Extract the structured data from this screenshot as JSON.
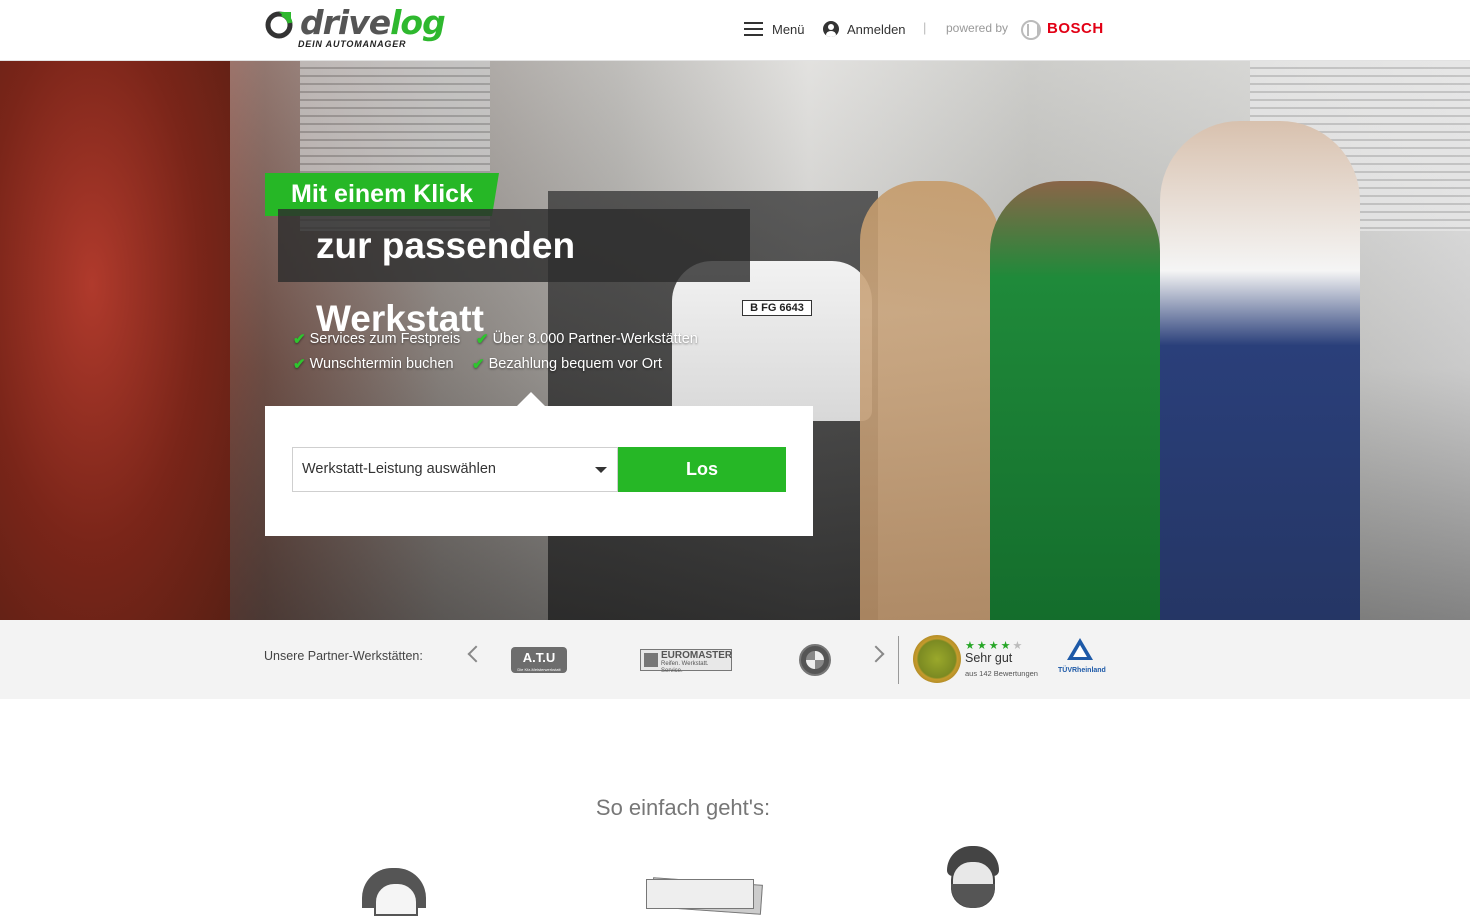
{
  "header": {
    "logo_text_a": "drive",
    "logo_text_b": "log",
    "logo_tagline": "DEIN AUTOMANAGER",
    "menu_label": "Menü",
    "login_label": "Anmelden",
    "separator": "|",
    "powered_by": "powered by",
    "brand": "BOSCH"
  },
  "hero": {
    "headline_1": "Mit einem Klick",
    "headline_2": "zur passenden Werkstatt",
    "plate": "B FG 6643",
    "usps": [
      "Services zum Festpreis",
      "Über 8.000 Partner-Werkstätten",
      "Wunschtermin buchen",
      "Bezahlung bequem vor Ort"
    ],
    "check_glyph": "✔",
    "search": {
      "select_value": "Werkstatt-Leistung auswählen",
      "button_label": "Los"
    }
  },
  "partners": {
    "label": "Unsere Partner-Werkstätten:",
    "logos": [
      {
        "name": "ATU",
        "text": "A.T.U",
        "sub": "Die Kfz-Meisterwerkstatt"
      },
      {
        "name": "Euromaster",
        "text": "EUROMASTER",
        "sub": "Reifen. Werkstatt. Service."
      },
      {
        "name": "BMW",
        "text": ""
      }
    ],
    "rating": {
      "stars_on": "★★★★",
      "stars_off": "★",
      "label": "Sehr gut",
      "count": "aus 142 Bewertungen"
    },
    "tuv": "TÜVRheinland"
  },
  "section": {
    "title": "So einfach geht's:"
  },
  "colors": {
    "accent_green": "#26b726",
    "bosch_red": "#e20015",
    "tuv_blue": "#1e5aa8"
  }
}
